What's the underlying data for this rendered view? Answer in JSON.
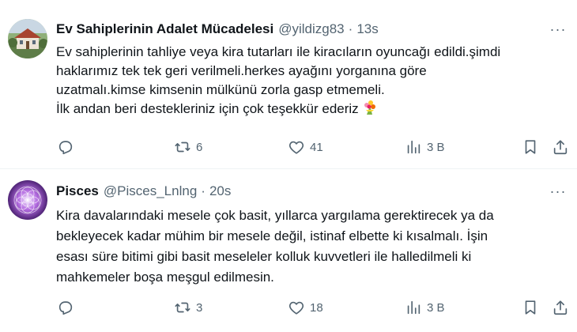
{
  "colors": {
    "text": "#0f1419",
    "secondary": "#536471",
    "divider": "#eff3f4"
  },
  "tweets": [
    {
      "display_name": "Ev Sahiplerinin Adalet Mücadelesi",
      "handle": "@yildizg83",
      "separator": "·",
      "time": "13s",
      "more": "···",
      "lines": [
        "Ev sahiplerinin tahliye veya kira tutarları ile kiracıların oyuncağı edildi.şimdi",
        "haklarımız tek tek geri verilmeli.herkes ayağını yorganına göre",
        "uzatmalı.kimse kimsenin mülkünü zorla gasp etmemeli.",
        "İlk andan beri destekleriniz için çok teşekkür ederiz"
      ],
      "emoji": "bouquet-icon",
      "reply_count": "",
      "retweet_count": "6",
      "like_count": "41",
      "view_count": "3 B"
    },
    {
      "display_name": "Pisces",
      "handle": "@Pisces_Lnlng",
      "separator": "·",
      "time": "20s",
      "more": "···",
      "lines": [
        "Kira davalarındaki mesele çok basit, yıllarca yargılama gerektirecek ya da",
        "bekleyecek kadar mühim bir mesele değil, istinaf elbette ki kısalmalı. İşin",
        "esası süre bitimi gibi basit meseleler kolluk kuvvetleri ile halledilmeli ki",
        "mahkemeler boşa meşgul edilmesin."
      ],
      "reply_count": "",
      "retweet_count": "3",
      "like_count": "18",
      "view_count": "3 B"
    }
  ]
}
